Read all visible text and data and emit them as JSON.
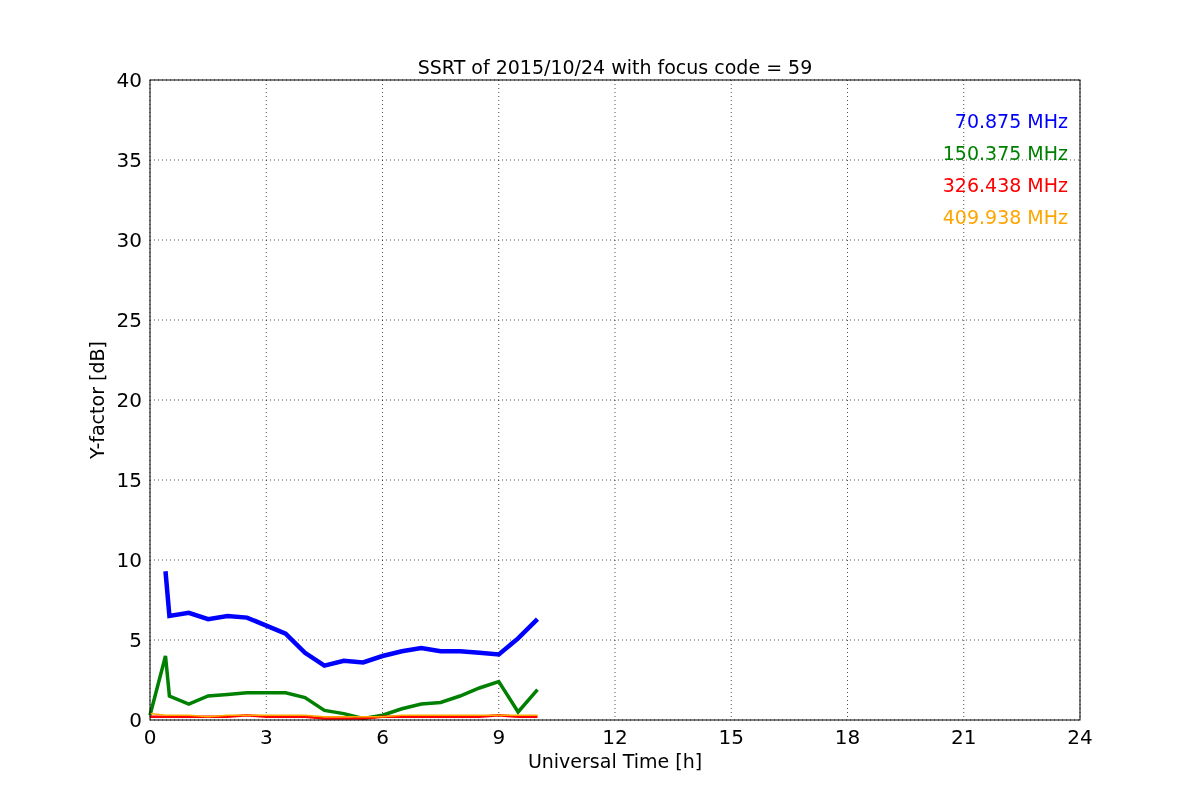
{
  "chart_data": {
    "type": "line",
    "title": "SSRT of 2015/10/24 with focus code = 59",
    "xlabel": "Universal Time [h]",
    "ylabel": "Y-factor [dB]",
    "x": [
      0,
      0.4,
      0.5,
      1,
      1.5,
      2,
      2.5,
      3,
      3.5,
      4,
      4.5,
      5,
      5.5,
      6,
      6.5,
      7,
      7.5,
      8,
      8.5,
      9,
      9.5,
      10
    ],
    "series": [
      {
        "name": "70.875 MHz",
        "color": "#0000ff",
        "values": [
          null,
          9.3,
          6.5,
          6.7,
          6.3,
          6.5,
          6.4,
          5.9,
          5.4,
          4.2,
          3.4,
          3.7,
          3.6,
          4.0,
          4.3,
          4.5,
          4.3,
          4.3,
          4.2,
          4.1,
          5.1,
          6.3
        ]
      },
      {
        "name": "150.375 MHz",
        "color": "#008000",
        "values": [
          0.3,
          4.0,
          1.5,
          1.0,
          1.5,
          1.6,
          1.7,
          1.7,
          1.7,
          1.4,
          0.6,
          0.4,
          0.1,
          0.3,
          0.7,
          1.0,
          1.1,
          1.5,
          2.0,
          2.4,
          0.5,
          1.9
        ]
      },
      {
        "name": "326.438 MHz",
        "color": "#ff0000",
        "values": [
          0.2,
          0.2,
          0.2,
          0.2,
          0.2,
          0.2,
          0.3,
          0.2,
          0.2,
          0.2,
          0.1,
          0.1,
          0.1,
          0.2,
          0.2,
          0.2,
          0.2,
          0.2,
          0.2,
          0.3,
          0.2,
          0.2
        ]
      },
      {
        "name": "409.938 MHz",
        "color": "#ffa500",
        "values": [
          0.4,
          0.3,
          0.3,
          0.3,
          0.2,
          0.3,
          0.3,
          0.3,
          0.3,
          0.3,
          0.2,
          0.2,
          0.2,
          0.2,
          0.3,
          0.3,
          0.3,
          0.3,
          0.3,
          0.3,
          0.3,
          0.3
        ]
      }
    ],
    "grid": true,
    "xlim": [
      0,
      24
    ],
    "ylim": [
      0,
      40
    ],
    "xticks": [
      0,
      3,
      6,
      9,
      12,
      15,
      18,
      21,
      24
    ],
    "yticks": [
      0,
      5,
      10,
      15,
      20,
      25,
      30,
      35,
      40
    ]
  }
}
